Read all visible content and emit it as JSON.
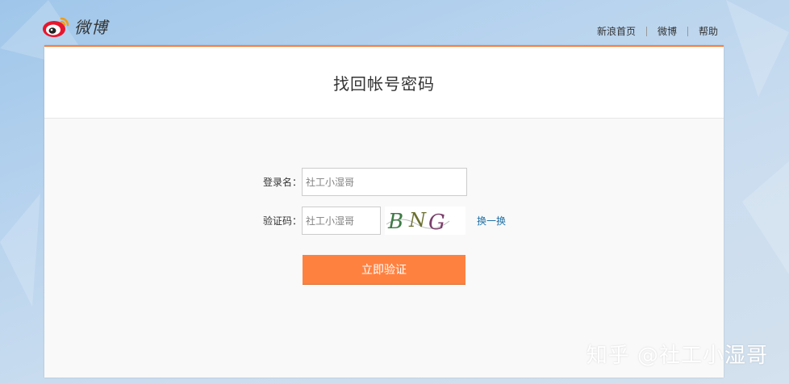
{
  "header": {
    "logo_text": "微博",
    "nav": [
      "新浪首页",
      "微博",
      "帮助"
    ]
  },
  "panel": {
    "title": "找回帐号密码"
  },
  "form": {
    "login_label": "登录名：",
    "login_value": "社工小湿哥",
    "captcha_label": "验证码：",
    "captcha_value": "社工小湿哥",
    "captcha_image_text": "BNG",
    "refresh_label": "换一换",
    "submit_label": "立即验证"
  },
  "watermark": "知乎 @社工小湿哥",
  "colors": {
    "accent": "#ff8140",
    "link": "#1d6fa5",
    "panel_border": "#fa7d3c"
  }
}
